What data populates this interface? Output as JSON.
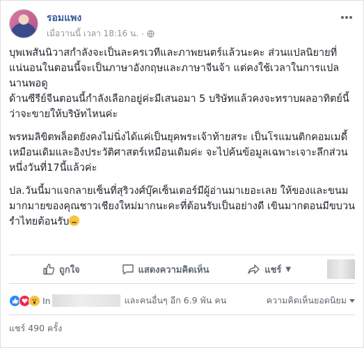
{
  "post": {
    "author": "รอมแพง",
    "time": "เมื่อวานนี้ เวลา 18:16 น.",
    "separator": "·",
    "paragraphs": [
      "บุพเพสันนิวาสกำลังจะเป็นละครเวทีและภาพยนตร์แล้วนะคะ ส่วนแปลนิยายที่แน่นอนในตอนนี้จะเป็นภาษาอังกฤษและภาษาจีนจ้า แต่คงใช้เวลาในการแปลนานพอดู\nด้านซีรีย์จีนตอนนี้กำลังเลือกอยู่ค่ะมีเสนอมา 5 บริษัทแล้วคงจะทราบผลอาทิตย์นี้ว่าจะขายให้บริษัทไหนค่ะ",
      "พรหมลิขิตพล็อตยังคงไม่นิ่งได้แค่เป็นยุคพระเจ้าท้ายสระ เป็นโรแมนติกคอมเมดี้เหมือนเดิมและอิงประวัติศาสตร์เหมือนเดิมค่ะ จะไปค้นข้อมูลเฉพาะเจาะลึกส่วนหนึ่งวันที่17นี้แล้วค่ะ",
      "ปล.วันนี้มาแจกลายเซ็นที่สุริวงศ์บุ๊คเซ็นเตอร์มีผู้อ่านมาเยอะเลย ให้ของและขนมมากมายของคุณชาวเชียงใหม่มากนะคะที่ต้อนรับเป็นอย่างดี เขินมากตอนมีขบวนรำไทยต้อนรับ"
    ]
  },
  "actions": {
    "like": "ถูกใจ",
    "comment": "แสดงความคิดเห็น",
    "share": "แชร์"
  },
  "reactions": {
    "prefix": "In",
    "suffix": "และคนอื่นๆ อีก 6.9 พัน คน",
    "sort_label": "ความคิดเห็นยอดนิยม"
  },
  "shares": {
    "label": "แชร์ 490 ครั้ง"
  },
  "colors": {
    "link": "#365899",
    "meta": "#90949c",
    "like": "#2d88ff",
    "love": "#f0284a",
    "wow": "#f7c43e"
  },
  "icons": [
    "globe-icon",
    "more-options-icon",
    "thumbs-up-icon",
    "comment-icon",
    "share-icon",
    "like-reaction-icon",
    "love-reaction-icon",
    "wow-reaction-icon",
    "blush-emoji-icon"
  ]
}
